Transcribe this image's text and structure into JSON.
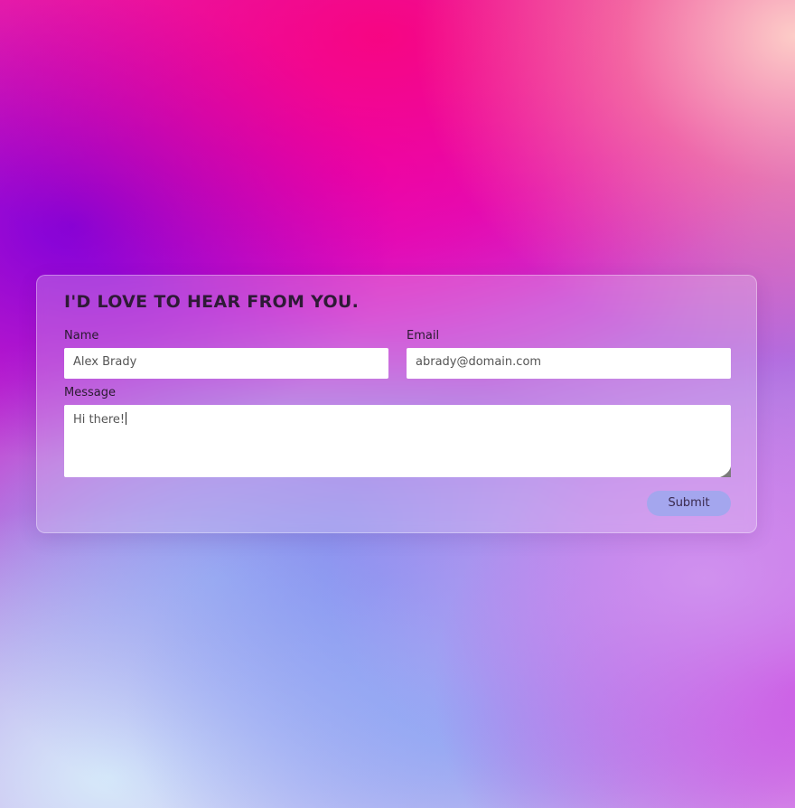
{
  "form": {
    "title": "I'D LOVE TO HEAR FROM YOU.",
    "name_label": "Name",
    "name_value": "Alex Brady",
    "email_label": "Email",
    "email_value": "abrady@domain.com",
    "message_label": "Message",
    "message_value": "Hi there!",
    "submit_label": "Submit"
  },
  "icons": {
    "resize": "resize-grip-icon"
  },
  "colors": {
    "submit_button": "#a4a6ee",
    "title_text": "#2e1a36"
  }
}
